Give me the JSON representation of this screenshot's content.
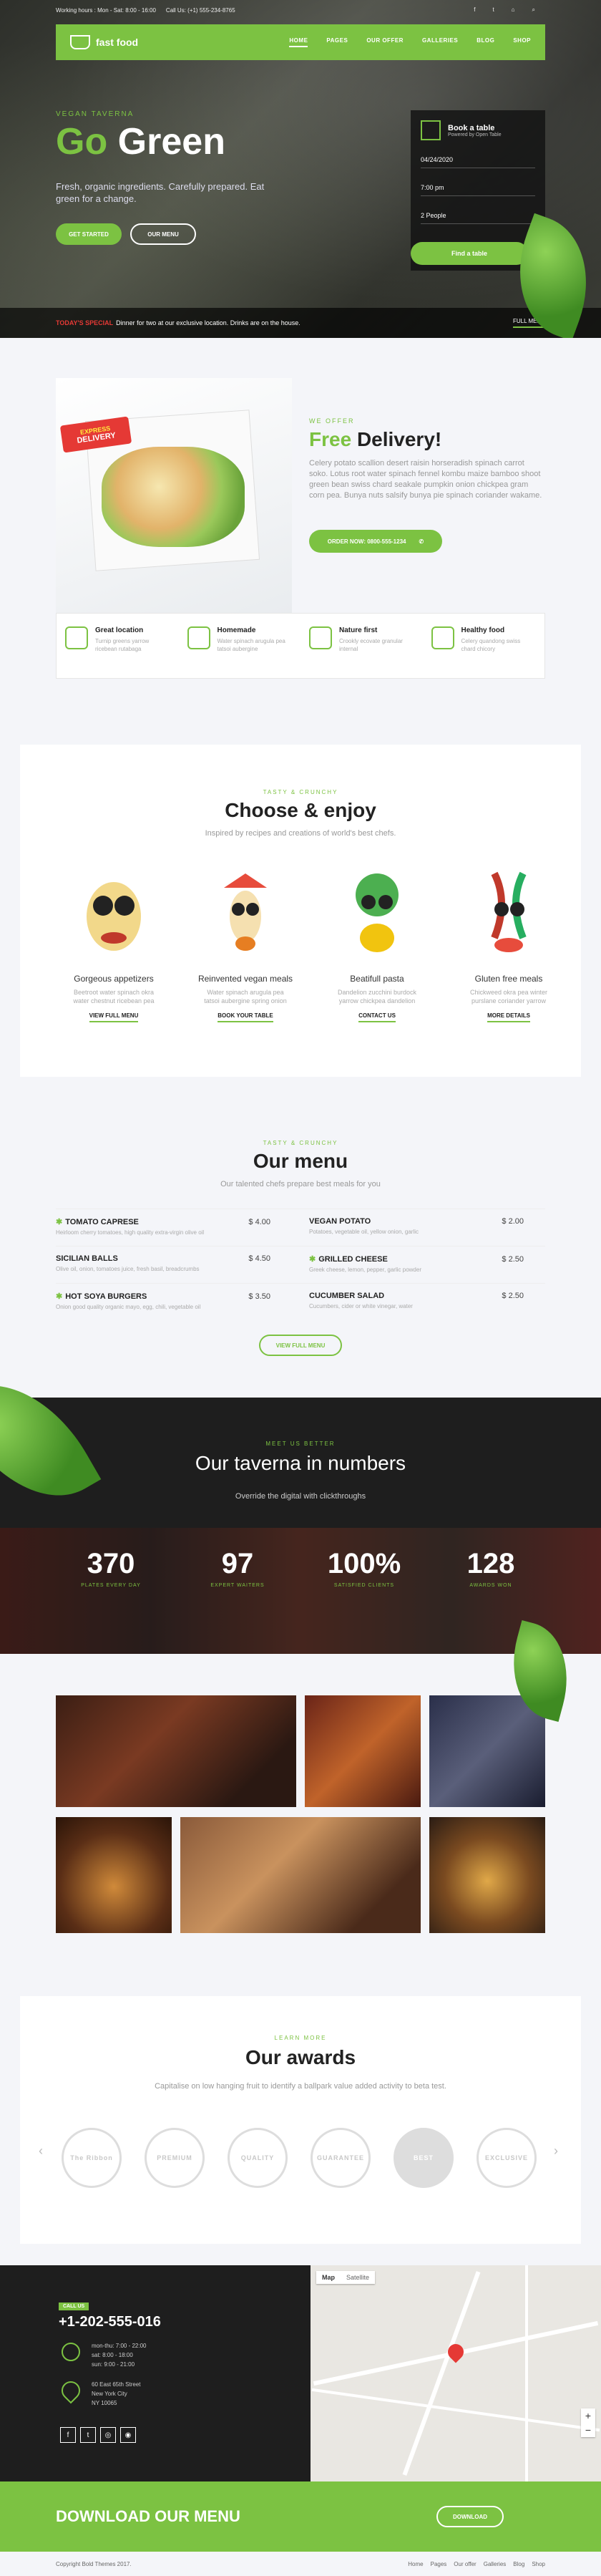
{
  "topbar": {
    "hours": "Working hours : Mon - Sat: 8:00 - 16:00",
    "call": "Call Us: (+1) 555-234-8765"
  },
  "nav": {
    "logo": "fast food",
    "items": [
      "HOME",
      "PAGES",
      "OUR OFFER",
      "GALLERIES",
      "BLOG",
      "SHOP"
    ]
  },
  "hero": {
    "subtitle": "VEGAN TAVERNA",
    "title_a": "Go ",
    "title_b": "Green",
    "desc": "Fresh, organic ingredients. Carefully prepared. Eat green for a change.",
    "btn_start": "GET STARTED",
    "btn_menu": "OUR MENU",
    "book": {
      "title": "Book a table",
      "powered": "Powered by Open Table",
      "date": "04/24/2020",
      "time": "7:00 pm",
      "people": "2 People",
      "btn": "Find a table"
    },
    "special_label": "TODAY'S SPECIAL",
    "special_text": "Dinner for two at our exclusive location. Drinks are on the house.",
    "full_menu": "FULL MENU"
  },
  "delivery": {
    "badge_a": "EXPRESS",
    "badge_b": "DELIVERY",
    "kicker": "WE OFFER",
    "title_a": "Free ",
    "title_b": "Delivery!",
    "text": "Celery potato scallion desert raisin horseradish spinach carrot soko. Lotus root water spinach fennel kombu maize bamboo shoot green bean swiss chard seakale pumpkin onion chickpea gram corn pea. Bunya nuts salsify bunya pie spinach coriander wakame.",
    "btn": "ORDER NOW: 0800-555-1234"
  },
  "features": [
    {
      "title": "Great location",
      "desc": "Turnip greens yarrow ricebean rutabaga"
    },
    {
      "title": "Homemade",
      "desc": "Water spinach arugula pea tatsoi aubergine"
    },
    {
      "title": "Nature first",
      "desc": "Crookly ecovate granular internal"
    },
    {
      "title": "Healthy food",
      "desc": "Celery quandong swiss chard chicory"
    }
  ],
  "choose": {
    "kicker": "TASTY & CRUNCHY",
    "title": "Choose & enjoy",
    "sub": "Inspired by recipes and creations of world's best chefs.",
    "dishes": [
      {
        "title": "Gorgeous appetizers",
        "desc": "Beetroot water spinach okra water chestnut ricebean pea",
        "link": "VIEW FULL MENU"
      },
      {
        "title": "Reinvented vegan meals",
        "desc": "Water spinach arugula pea tatsoi aubergine spring onion",
        "link": "BOOK YOUR TABLE"
      },
      {
        "title": "Beatifull pasta",
        "desc": "Dandelion zucchini burdock yarrow chickpea dandelion",
        "link": "CONTACT US"
      },
      {
        "title": "Gluten free meals",
        "desc": "Chickweed okra pea winter purslane coriander yarrow",
        "link": "MORE DETAILS"
      }
    ]
  },
  "menu": {
    "kicker": "TASTY & CRUNCHY",
    "title": "Our menu",
    "sub": "Our talented chefs prepare best meals for you",
    "items": [
      {
        "name": "TOMATO CAPRESE",
        "price": "$ 4.00",
        "desc": "Heirloom cherry tomatoes, high quality extra-virgin olive oil",
        "star": true
      },
      {
        "name": "VEGAN POTATO",
        "price": "$ 2.00",
        "desc": "Potatoes, vegetable oil, yellow onion, garlic",
        "star": false
      },
      {
        "name": "SICILIAN BALLS",
        "price": "$ 4.50",
        "desc": "Olive oil, onion, tomatoes juice, fresh basil, breadcrumbs",
        "star": false
      },
      {
        "name": "GRILLED CHEESE",
        "price": "$ 2.50",
        "desc": "Greek cheese, lemon, pepper, garlic powder",
        "star": true
      },
      {
        "name": "HOT SOYA BURGERS",
        "price": "$ 3.50",
        "desc": "Onion good quality organic mayo, egg, chili, vegetable oil",
        "star": true
      },
      {
        "name": "CUCUMBER SALAD",
        "price": "$ 2.50",
        "desc": "Cucumbers, cider or white vinegar, water",
        "star": false
      }
    ],
    "btn": "VIEW FULL MENU"
  },
  "numbers": {
    "kicker": "MEET US BETTER",
    "title": "Our taverna in numbers",
    "sub": "Override the digital with clickthroughs",
    "stats": [
      {
        "n": "370",
        "l": "PLATES EVERY DAY"
      },
      {
        "n": "97",
        "l": "EXPERT WAITERS"
      },
      {
        "n": "100%",
        "l": "SATISFIED CLIENTS"
      },
      {
        "n": "128",
        "l": "AWARDS WON"
      }
    ]
  },
  "awards": {
    "kicker": "LEARN MORE",
    "title": "Our awards",
    "sub": "Capitalise on low hanging fruit to identify a ballpark value added activity to beta test.",
    "items": [
      "The Ribbon",
      "PREMIUM",
      "QUALITY",
      "GUARANTEE",
      "BEST",
      "EXCLUSIVE"
    ]
  },
  "footer": {
    "call_label": "CALL US",
    "phone": "+1-202-555-016",
    "hours_a": "mon-thu: 7:00 - 22:00",
    "hours_b": "sat: 8:00 - 18:00",
    "hours_c": "sun: 9:00 - 21:00",
    "addr_a": "60 East 65th Street",
    "addr_b": "New York City",
    "addr_c": "NY 10065",
    "map_a": "Map",
    "map_b": "Satellite"
  },
  "download": {
    "title": "DOWNLOAD OUR MENU",
    "btn": "DOWNLOAD"
  },
  "copyright": {
    "text": "Copyright Bold Themes 2017.",
    "links": [
      "Home",
      "Pages",
      "Our offer",
      "Galleries",
      "Blog",
      "Shop"
    ]
  }
}
